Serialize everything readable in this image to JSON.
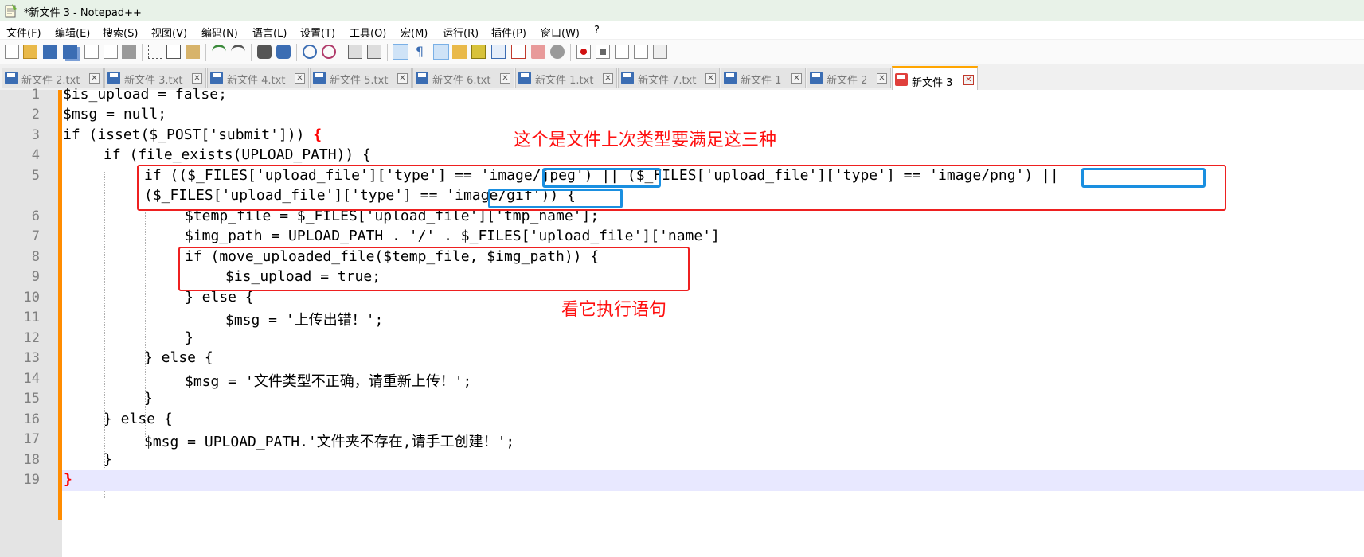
{
  "window": {
    "title": "*新文件 3 - Notepad++"
  },
  "menu": [
    "文件(F)",
    "编辑(E)",
    "搜索(S)",
    "视图(V)",
    "编码(N)",
    "语言(L)",
    "设置(T)",
    "工具(O)",
    "宏(M)",
    "运行(R)",
    "插件(P)",
    "窗口(W)",
    "?"
  ],
  "toolbar": [
    "new-file-icon",
    "open-file-icon",
    "save-icon",
    "save-all-icon",
    "close-icon",
    "close-all-icon",
    "print-icon",
    "cut-icon",
    "copy-icon",
    "paste-icon",
    "undo-icon",
    "redo-icon",
    "find-icon",
    "replace-icon",
    "zoom-in-icon",
    "zoom-out-icon",
    "sync-vertical-icon",
    "sync-horizontal-icon",
    "word-wrap-icon",
    "show-all-chars-icon",
    "indent-guide-icon",
    "document-map-icon",
    "function-list-icon",
    "folder-workspace-icon",
    "monitoring-icon",
    "record-macro-icon",
    "stop-macro-icon",
    "playback-macro-icon",
    "run-macro-multiple-icon",
    "save-macro-icon"
  ],
  "tabs": [
    {
      "label": "新文件 2.txt",
      "active": false
    },
    {
      "label": "新文件 3.txt",
      "active": false
    },
    {
      "label": "新文件 4.txt",
      "active": false
    },
    {
      "label": "新文件 5.txt",
      "active": false
    },
    {
      "label": "新文件 6.txt",
      "active": false
    },
    {
      "label": "新文件 1.txt",
      "active": false
    },
    {
      "label": "新文件 7.txt",
      "active": false
    },
    {
      "label": "新文件 1",
      "active": false
    },
    {
      "label": "新文件 2",
      "active": false
    },
    {
      "label": "新文件 3",
      "active": true
    }
  ],
  "tab_close": "✕",
  "lines": [
    {
      "num": "1",
      "text": "$is_upload = false;"
    },
    {
      "num": "2",
      "text": "$msg = null;"
    },
    {
      "num": "3",
      "text": "if (isset($_POST['submit'])) ",
      "brace": "{"
    },
    {
      "num": "4",
      "text": "if (file_exists(UPLOAD_PATH)) {"
    },
    {
      "num": "5",
      "text": "if (($_FILES['upload_file']['type'] == 'image/jpeg') || ($_FILES['upload_file']['type'] == 'image/png') ||"
    },
    {
      "num": "",
      "text": "($_FILES['upload_file']['type'] == 'image/gif')) {"
    },
    {
      "num": "6",
      "text": "$temp_file = $_FILES['upload_file']['tmp_name'];"
    },
    {
      "num": "7",
      "text": "$img_path = UPLOAD_PATH . '/' . $_FILES['upload_file']['name']"
    },
    {
      "num": "8",
      "text": "if (move_uploaded_file($temp_file, $img_path)) {"
    },
    {
      "num": "9",
      "text": "$is_upload = true;"
    },
    {
      "num": "10",
      "text": "} else {"
    },
    {
      "num": "11",
      "text": "$msg = '上传出错！';"
    },
    {
      "num": "12",
      "text": "}"
    },
    {
      "num": "13",
      "text": "} else {"
    },
    {
      "num": "14",
      "text": "$msg = '文件类型不正确，请重新上传！';"
    },
    {
      "num": "15",
      "text": "}"
    },
    {
      "num": "16",
      "text": "} else {"
    },
    {
      "num": "17",
      "text": "$msg = UPLOAD_PATH.'文件夹不存在,请手工创建！';"
    },
    {
      "num": "18",
      "text": "}"
    },
    {
      "num": "19",
      "text": "",
      "brace": "}"
    }
  ],
  "annotations": {
    "note1": "这个是文件上次类型要满足这三种",
    "note2": "看它执行语句"
  },
  "colors": {
    "fold_margin": "#ff8c00",
    "current_line": "#e8e8ff",
    "annotation_red": "#ff1010",
    "annotation_blue": "#1a8fe0"
  }
}
